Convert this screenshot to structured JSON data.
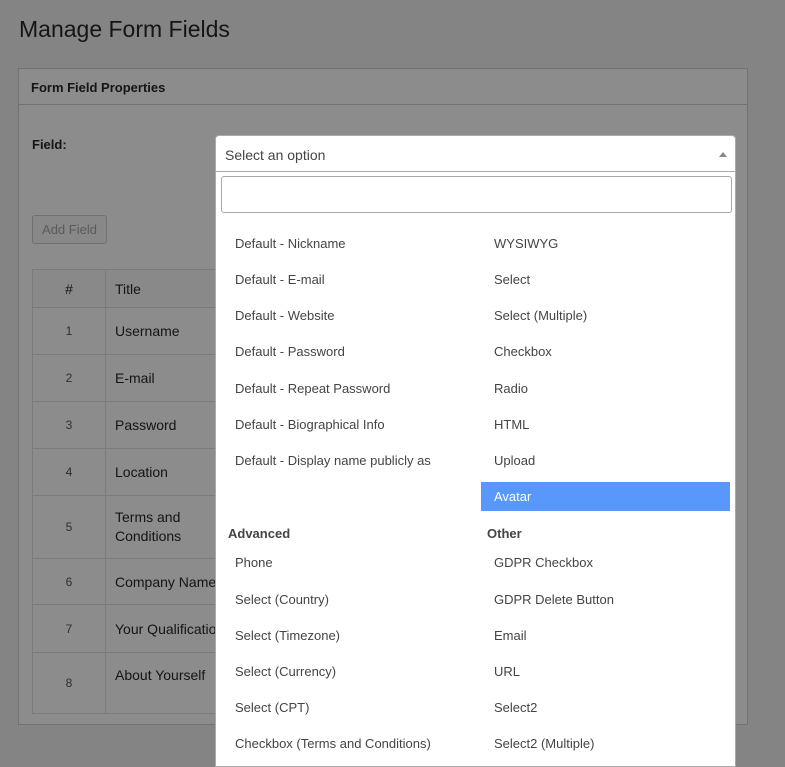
{
  "page": {
    "title": "Manage Form Fields"
  },
  "panel": {
    "header": "Form Field Properties",
    "field_label": "Field:",
    "add_button": "Add Field"
  },
  "table": {
    "headers": [
      "#",
      "Title"
    ],
    "rows": [
      {
        "num": "1",
        "title": "Username"
      },
      {
        "num": "2",
        "title": "E-mail"
      },
      {
        "num": "3",
        "title": "Password"
      },
      {
        "num": "4",
        "title": "Location"
      },
      {
        "num": "5",
        "title": "Terms and\nConditions"
      },
      {
        "num": "6",
        "title": "Company Name"
      },
      {
        "num": "7",
        "title": "Your Qualification"
      },
      {
        "num": "8",
        "title": "About Yourself"
      }
    ]
  },
  "select": {
    "placeholder": "Select an option",
    "search_value": "",
    "col1_options": [
      "Default - Nickname",
      "Default - E-mail",
      "Default - Website",
      "Default - Password",
      "Default - Repeat Password",
      "Default - Biographical Info",
      "Default - Display name publicly as"
    ],
    "col2_options": [
      "WYSIWYG",
      "Select",
      "Select (Multiple)",
      "Checkbox",
      "Radio",
      "HTML",
      "Upload",
      "Avatar"
    ],
    "highlighted": "Avatar",
    "groups": [
      {
        "label": "Advanced",
        "options": [
          "Phone",
          "Select (Country)",
          "Select (Timezone)",
          "Select (Currency)",
          "Select (CPT)",
          "Checkbox (Terms and Conditions)"
        ]
      },
      {
        "label": "Other",
        "options": [
          "GDPR Checkbox",
          "GDPR Delete Button",
          "Email",
          "URL",
          "Select2",
          "Select2 (Multiple)"
        ]
      }
    ]
  }
}
